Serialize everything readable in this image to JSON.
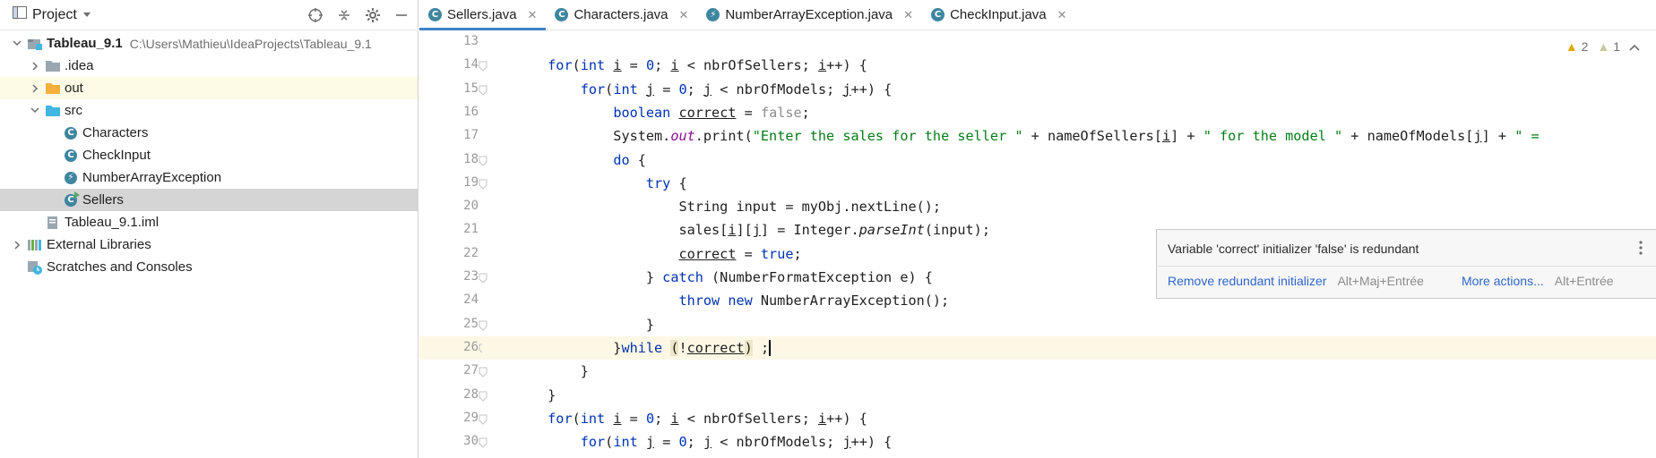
{
  "project_panel": {
    "title": "Project",
    "tree": [
      {
        "indent": 0,
        "arrow": "v",
        "icon": "module",
        "label": "Tableau_9.1",
        "bold": true,
        "path": "C:\\Users\\Mathieu\\IdeaProjects\\Tableau_9.1"
      },
      {
        "indent": 1,
        "arrow": ">",
        "icon": "folder",
        "label": ".idea"
      },
      {
        "indent": 1,
        "arrow": ">",
        "icon": "folder-orange",
        "label": "out",
        "highlight": true
      },
      {
        "indent": 1,
        "arrow": "v",
        "icon": "folder-blue",
        "label": "src"
      },
      {
        "indent": 2,
        "arrow": "",
        "icon": "class",
        "label": "Characters"
      },
      {
        "indent": 2,
        "arrow": "",
        "icon": "class",
        "label": "CheckInput"
      },
      {
        "indent": 2,
        "arrow": "",
        "icon": "exception",
        "label": "NumberArrayException"
      },
      {
        "indent": 2,
        "arrow": "",
        "icon": "class-run",
        "label": "Sellers",
        "selected": true
      },
      {
        "indent": 1,
        "arrow": "",
        "icon": "iml",
        "label": "Tableau_9.1.iml"
      },
      {
        "indent": 0,
        "arrow": ">",
        "icon": "library",
        "label": "External Libraries"
      },
      {
        "indent": 0,
        "arrow": "",
        "icon": "scratches",
        "label": "Scratches and Consoles"
      }
    ]
  },
  "tabs": [
    {
      "label": "Sellers.java",
      "active": true
    },
    {
      "label": "Characters.java"
    },
    {
      "label": "NumberArrayException.java"
    },
    {
      "label": "CheckInput.java"
    }
  ],
  "annotations": {
    "warnings": "2",
    "weak_warnings": "1"
  },
  "code_lines": [
    {
      "n": "13",
      "html": ""
    },
    {
      "n": "14",
      "html": "        <span class=\"kw\">for</span>(<span class=\"kw\">int</span> <span class=\"ul\">i</span> = <span class=\"kw\">0</span>; <span class=\"ul\">i</span> &lt; nbrOfSellers; <span class=\"ul\">i</span>++) {"
    },
    {
      "n": "15",
      "html": "            <span class=\"kw\">for</span>(<span class=\"kw\">int</span> <span class=\"ul\">j</span> = <span class=\"kw\">0</span>; <span class=\"ul\">j</span> &lt; nbrOfModels; <span class=\"ul\">j</span>++) {"
    },
    {
      "n": "16",
      "html": "                <span class=\"kw\">boolean</span> <span class=\"ul\">correct</span> = <span class=\"gray\">false</span>;"
    },
    {
      "n": "17",
      "html": "                System.<span class=\"fld\">out</span>.print(<span class=\"str\">\"Enter the sales for the seller \"</span> + nameOfSellers[<span class=\"ul\">i</span>] + <span class=\"str\">\" for the model \"</span> + nameOfModels[<span class=\"ul\">j</span>] + <span class=\"str\">\" = </span>"
    },
    {
      "n": "18",
      "html": "                <span class=\"kw\">do</span> {"
    },
    {
      "n": "19",
      "html": "                    <span class=\"kw\">try</span> {"
    },
    {
      "n": "20",
      "html": "                        String input = myObj.nextLine();"
    },
    {
      "n": "21",
      "html": "                        sales[<span class=\"ul\">i</span>][<span class=\"ul\">j</span>] = Integer.<span class=\"it\">parseInt</span>(input);"
    },
    {
      "n": "22",
      "html": "                        <span class=\"ul\">correct</span> = <span class=\"kw\">true</span>;"
    },
    {
      "n": "23",
      "html": "                    } <span class=\"kw\">catch</span> (NumberFormatException e) {"
    },
    {
      "n": "24",
      "html": "                        <span class=\"kw\">throw new</span> NumberArrayException();"
    },
    {
      "n": "25",
      "html": "                    }"
    },
    {
      "n": "26",
      "html": "                }<span class=\"kw\">while</span> <span class=\"match\">(</span>!<span class=\"ul\">correct</span><span class=\"match\">)</span> ;<span class=\"caret\"></span>",
      "current": true
    },
    {
      "n": "27",
      "html": "            }"
    },
    {
      "n": "28",
      "html": "        }"
    },
    {
      "n": "29",
      "html": "        <span class=\"kw\">for</span>(<span class=\"kw\">int</span> <span class=\"ul\">i</span> = <span class=\"kw\">0</span>; <span class=\"ul\">i</span> &lt; nbrOfSellers; <span class=\"ul\">i</span>++) {"
    },
    {
      "n": "30",
      "html": "            <span class=\"kw\">for</span>(<span class=\"kw\">int</span> <span class=\"ul\">j</span> = <span class=\"kw\">0</span>; <span class=\"ul\">j</span> &lt; nbrOfModels; <span class=\"ul\">j</span>++) {"
    }
  ],
  "popup": {
    "message": "Variable 'correct' initializer 'false' is redundant",
    "action1": "Remove redundant initializer",
    "shortcut1": "Alt+Maj+Entrée",
    "action2": "More actions...",
    "shortcut2": "Alt+Entrée"
  },
  "colors": {
    "keyword": "#0033b3",
    "string": "#067d17",
    "accent": "#4083c9"
  }
}
